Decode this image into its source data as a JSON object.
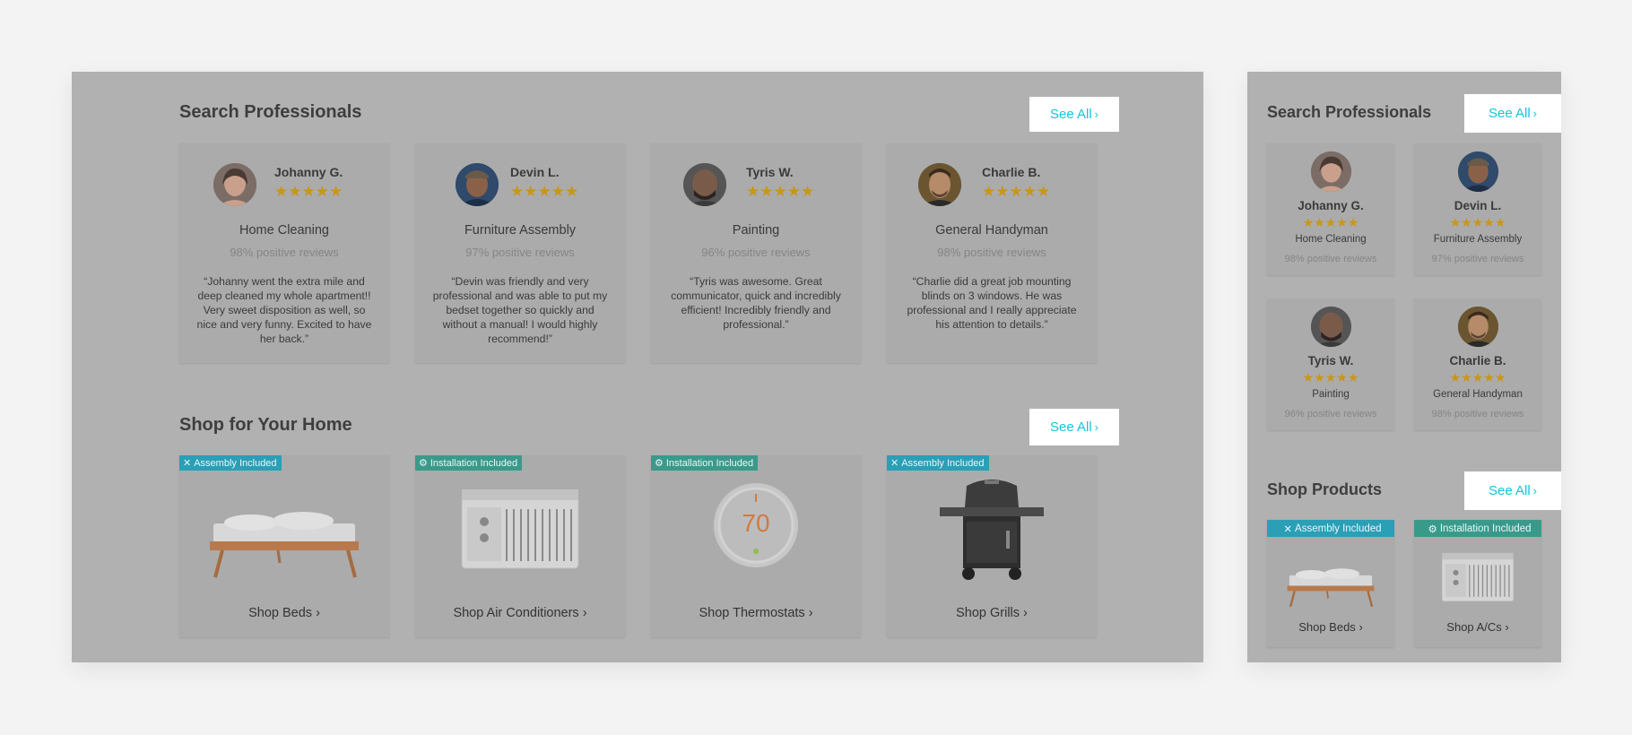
{
  "desktop": {
    "professionals": {
      "title": "Search Professionals",
      "see_all": "See All",
      "pros": [
        {
          "name": "Johanny G.",
          "stars": "★★★★★",
          "service": "Home Cleaning",
          "reviews": "98% positive reviews",
          "quote": "“Johanny went the extra mile and deep cleaned my whole apartment!! Very sweet disposition as well, so nice and very funny. Excited to have her back.”"
        },
        {
          "name": "Devin L.",
          "stars": "★★★★★",
          "service": "Furniture Assembly",
          "reviews": "97% positive reviews",
          "quote": "“Devin was friendly and very professional and was able to put my bedset together so quickly and without a manual! I would highly recommend!”"
        },
        {
          "name": "Tyris W.",
          "stars": "★★★★★",
          "service": "Painting",
          "reviews": "96% positive reviews",
          "quote": "“Tyris was awesome. Great communicator, quick and incredibly efficient! Incredibly friendly and professional.”"
        },
        {
          "name": "Charlie B.",
          "stars": "★★★★★",
          "service": "General Handyman",
          "reviews": "98% positive reviews",
          "quote": "“Charlie did a great job mounting blinds on 3 windows. He was professional and I really appreciate his attention to details.”"
        }
      ]
    },
    "shop": {
      "title": "Shop for Your Home",
      "see_all": "See All",
      "products": [
        {
          "badge": "Assembly Included",
          "badge_type": "assembly",
          "badge_icon": "tools-icon",
          "link": "Shop Beds",
          "image": "bed-image"
        },
        {
          "badge": "Installation Included",
          "badge_type": "install",
          "badge_icon": "gear-icon",
          "link": "Shop Air Conditioners",
          "image": "air-conditioner-image"
        },
        {
          "badge": "Installation Included",
          "badge_type": "install",
          "badge_icon": "gear-icon",
          "link": "Shop Thermostats",
          "image": "thermostat-image",
          "thermostat_reading": "70"
        },
        {
          "badge": "Assembly Included",
          "badge_type": "assembly",
          "badge_icon": "tools-icon",
          "link": "Shop Grills",
          "image": "grill-image"
        }
      ]
    }
  },
  "mobile": {
    "professionals": {
      "title": "Search Professionals",
      "see_all": "See All",
      "pros": [
        {
          "name": "Johanny G.",
          "stars": "★★★★★",
          "service": "Home Cleaning",
          "reviews": "98% positive reviews"
        },
        {
          "name": "Devin L.",
          "stars": "★★★★★",
          "service": "Furniture Assembly",
          "reviews": "97% positive reviews"
        },
        {
          "name": "Tyris W.",
          "stars": "★★★★★",
          "service": "Painting",
          "reviews": "96% positive reviews"
        },
        {
          "name": "Charlie B.",
          "stars": "★★★★★",
          "service": "General Handyman",
          "reviews": "98% positive reviews"
        }
      ]
    },
    "shop": {
      "title": "Shop Products",
      "see_all": "See All",
      "products": [
        {
          "badge": "Assembly Included",
          "badge_type": "assembly",
          "badge_icon": "tools-icon",
          "link": "Shop Beds",
          "image": "bed-image"
        },
        {
          "badge": "Installation Included",
          "badge_type": "install",
          "badge_icon": "gear-icon",
          "link": "Shop A/Cs",
          "image": "air-conditioner-image"
        }
      ]
    }
  },
  "colors": {
    "accent": "#14c4dc",
    "overlay": "#b1b1b1",
    "star": "#c8961a",
    "badge_assembly": "#2a9fb6",
    "badge_install": "#3a9a8a"
  },
  "rating": {
    "stars_filled": 5,
    "stars_total": 5
  }
}
